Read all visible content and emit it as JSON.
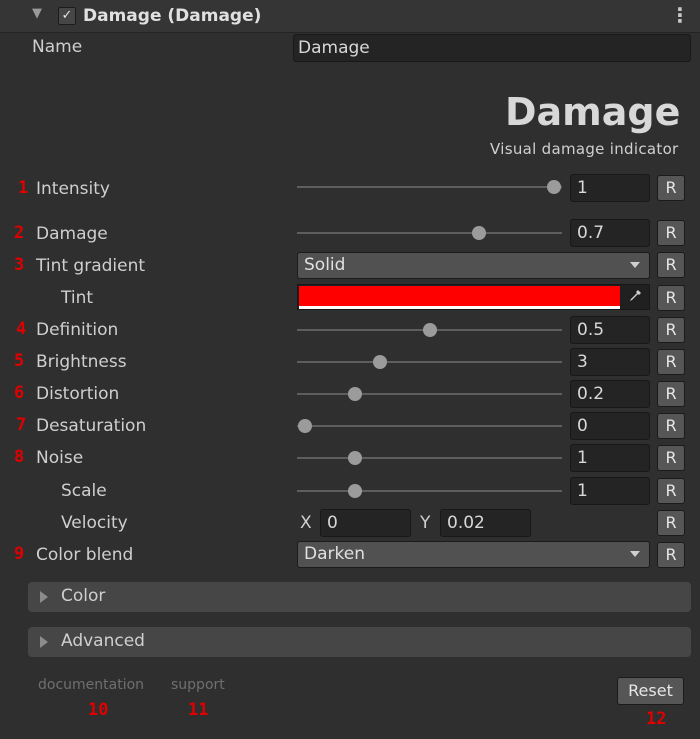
{
  "header": {
    "title": "Damage (Damage)",
    "enabled_check": "✓",
    "menu_icon": "kebab-menu-icon"
  },
  "name_field": {
    "label": "Name",
    "value": "Damage"
  },
  "logo": {
    "text": "Damage",
    "subtitle": "Visual damage indicator"
  },
  "properties": [
    {
      "num": "1",
      "label": "Intensity",
      "value": "1",
      "slider": 1.0
    },
    {
      "num": "2",
      "label": "Damage",
      "value": "0.7",
      "slider": 0.7
    },
    {
      "num": "3",
      "label": "Tint gradient",
      "value": "Solid"
    },
    {
      "num": "",
      "label": "Tint",
      "color": "#ff0000"
    },
    {
      "num": "4",
      "label": "Definition",
      "value": "0.5",
      "slider": 0.5
    },
    {
      "num": "5",
      "label": "Brightness",
      "value": "3",
      "slider": 0.3
    },
    {
      "num": "6",
      "label": "Distortion",
      "value": "0.2",
      "slider": 0.2
    },
    {
      "num": "7",
      "label": "Desaturation",
      "value": "0",
      "slider": 0.0
    },
    {
      "num": "8",
      "label": "Noise",
      "value": "1",
      "slider": 0.2
    },
    {
      "num": "",
      "label": "Scale",
      "value": "1",
      "slider": 0.2
    },
    {
      "num": "",
      "label": "Velocity",
      "x_label": "X",
      "x_value": "0",
      "y_label": "Y",
      "y_value": "0.02"
    },
    {
      "num": "9",
      "label": "Color blend",
      "value": "Darken"
    }
  ],
  "reset_label": "R",
  "foldouts": {
    "color": "Color",
    "advanced": "Advanced"
  },
  "footer": {
    "documentation": "documentation",
    "documentation_num": "10",
    "support": "support",
    "support_num": "11",
    "reset": "Reset",
    "reset_num": "12"
  },
  "colors": {
    "accent_numbers": "#e00000",
    "tint": "#ff0000",
    "background": "#2f2f2f"
  }
}
